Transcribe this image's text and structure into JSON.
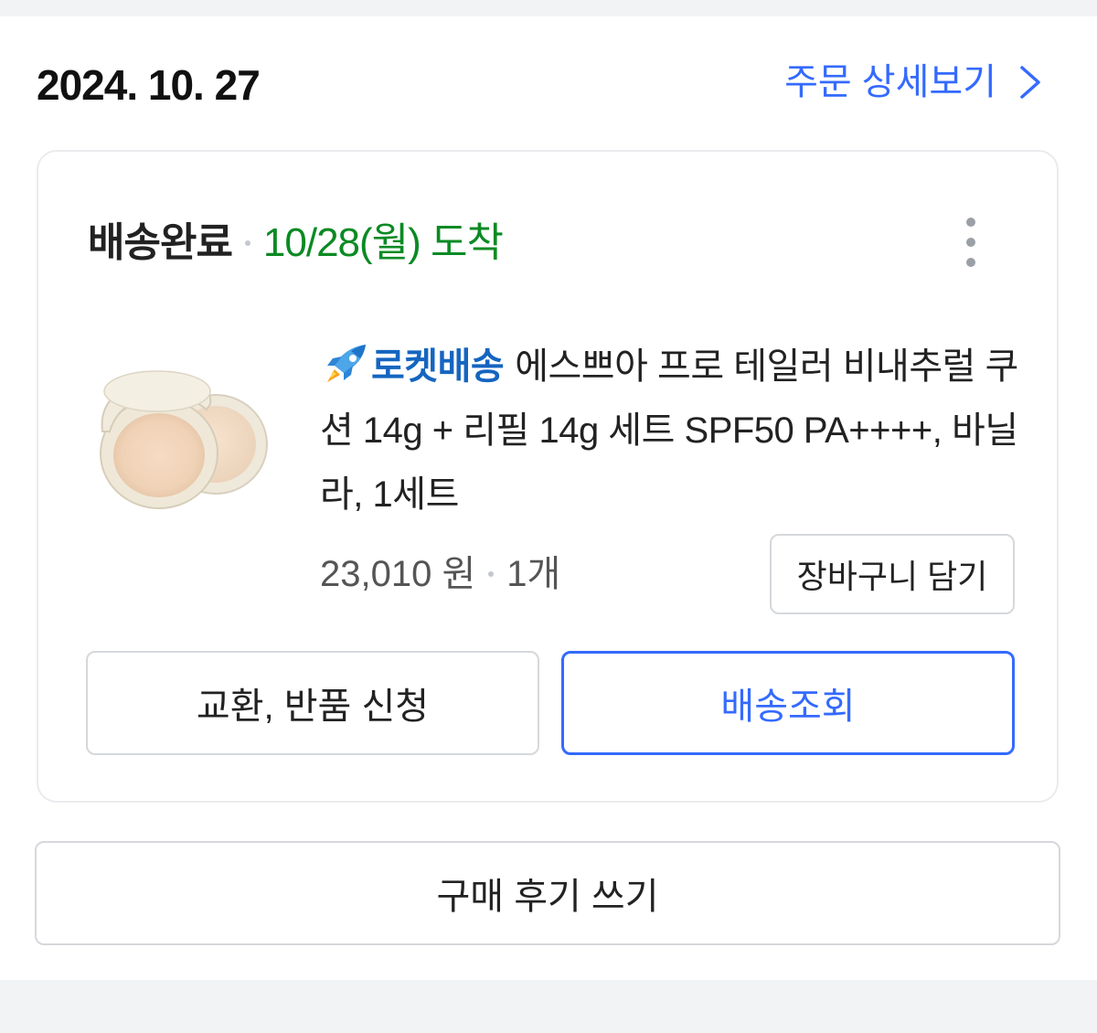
{
  "header": {
    "date": "2024. 10. 27",
    "detail_link_label": "주문 상세보기"
  },
  "order": {
    "status_label": "배송완료",
    "arrival_text": "10/28(월) 도착",
    "product": {
      "delivery_badge": "로켓배송",
      "title": "에스쁘아 프로 테일러 비내추럴 쿠션 14g + 리필 14g 세트 SPF50 PA++++, 바닐라, 1세트",
      "price": "23,010 원",
      "quantity": "1개",
      "image_icon": "cushion-compact-image"
    },
    "buttons": {
      "add_to_cart": "장바구니 담기",
      "exchange_return": "교환, 반품 신청",
      "track_shipping": "배송조회"
    }
  },
  "review_button_label": "구매 후기 쓰기",
  "colors": {
    "accent_blue": "#346aff",
    "arrival_green": "#0a8a23",
    "rocket_badge_blue": "#1565c0",
    "border": "#d5d8dc",
    "background_band": "#f2f3f5"
  }
}
